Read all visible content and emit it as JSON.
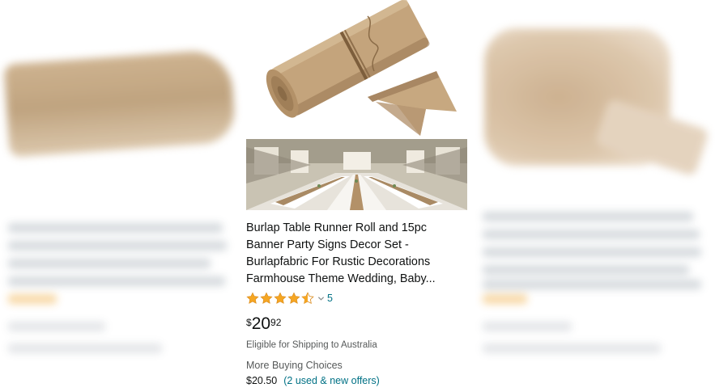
{
  "product": {
    "title": "Burlap Table Runner Roll and 15pc Banner Party Signs Decor Set - Burlapfabric For Rustic Decorations Farmhouse Theme Wedding, Baby...",
    "rating": {
      "stars": 4.5,
      "count": "5"
    },
    "price": {
      "symbol": "$",
      "whole": "20",
      "fraction": "92"
    },
    "shipping": "Eligible for Shipping to Australia",
    "more_buying_choices": {
      "label": "More Buying Choices",
      "price": "$20.50",
      "offers_link": "(2 used & new offers)"
    }
  },
  "colors": {
    "star": "#f5a623",
    "link": "#007185",
    "text": "#0f1111",
    "secondary_text": "#565959",
    "burlap": "#c4a47c"
  }
}
